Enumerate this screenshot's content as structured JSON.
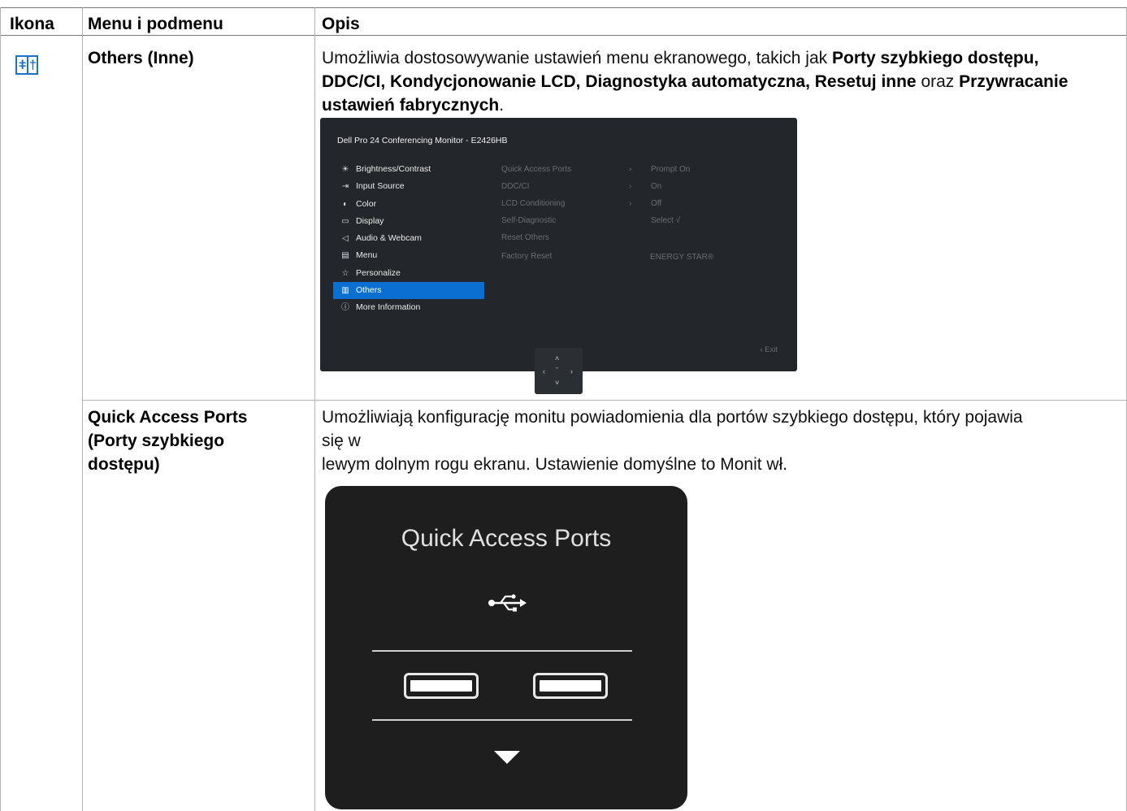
{
  "table": {
    "headers": {
      "icon": "Ikona",
      "menu": "Menu i podmenu",
      "desc": "Opis"
    }
  },
  "rows": [
    {
      "icon": "others-sliders-icon",
      "menu": "Others (Inne)",
      "desc": {
        "t1": "Umożliwia dostosowywanie ustawień menu ekranowego, takich jak ",
        "b1": "Porty szybkiego dostępu,",
        "b2": "DDC/CI, Kondycjonowanie LCD, Diagnostyka automatyczna, Resetuj inne",
        "t2": " oraz ",
        "b3": "Przywracanie",
        "b4": "ustawień fabrycznych",
        "t3": "."
      }
    },
    {
      "menu_lines": [
        "Quick Access Ports",
        "(Porty szybkiego",
        "dostępu)"
      ],
      "desc_lines": [
        "Umożliwiają konfigurację monitu powiadomienia dla portów szybkiego dostępu, który pojawia",
        "się w",
        "lewym dolnym rogu ekranu. Ustawienie domyślne to Monit wł."
      ]
    }
  ],
  "osd": {
    "title": "Dell Pro 24 Conferencing Monitor - E2426HB",
    "menu": [
      {
        "icon": "sun-icon",
        "glyph": "☀",
        "label": "Brightness/Contrast"
      },
      {
        "icon": "input-source-icon",
        "glyph": "⇥",
        "label": "Input Source"
      },
      {
        "icon": "color-palette-icon",
        "glyph": "◐",
        "label": "Color"
      },
      {
        "icon": "display-icon",
        "glyph": "▭",
        "label": "Display"
      },
      {
        "icon": "speaker-icon",
        "glyph": "◁",
        "label": "Audio & Webcam"
      },
      {
        "icon": "menu-icon",
        "glyph": "▤",
        "label": "Menu"
      },
      {
        "icon": "star-icon",
        "glyph": "☆",
        "label": "Personalize"
      },
      {
        "icon": "others-icon",
        "glyph": "▥",
        "label": "Others",
        "active": true
      },
      {
        "icon": "info-icon",
        "glyph": "ⓘ",
        "label": "More Information"
      }
    ],
    "sub": [
      {
        "label": "Quick Access Ports",
        "arrow": "›",
        "value": "Prompt On"
      },
      {
        "label": "DDC/CI",
        "arrow": "›",
        "value": "On"
      },
      {
        "label": "LCD Conditioning",
        "arrow": "›",
        "value": "Off"
      },
      {
        "label": "Self-Diagnostic",
        "arrow": "",
        "value": "Select √"
      },
      {
        "label": "Reset Others",
        "arrow": "",
        "value": ""
      },
      {
        "label": "Factory Reset",
        "arrow": "",
        "value": "ENERGY STAR®"
      }
    ],
    "exit": "‹  Exit"
  },
  "qap_dialog": {
    "title": "Quick Access Ports",
    "usb_icon": "usb-icon"
  }
}
